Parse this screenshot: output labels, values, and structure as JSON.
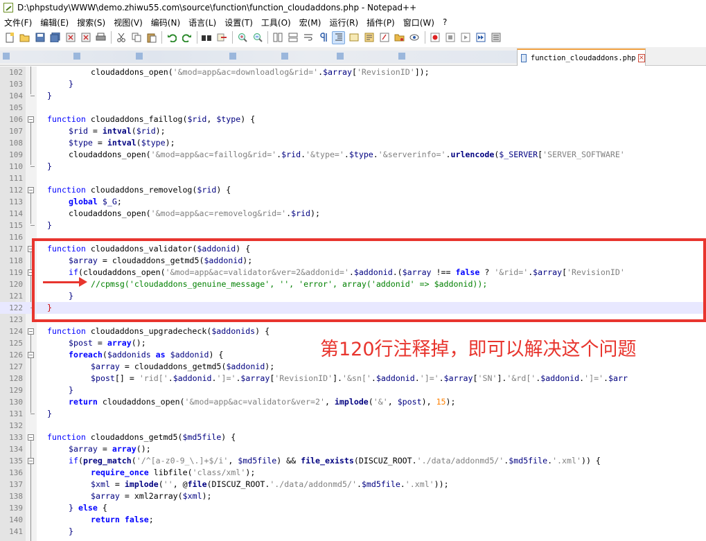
{
  "window": {
    "title": "D:\\phpstudy\\WWW\\demo.zhiwu55.com\\source\\function\\function_cloudaddons.php - Notepad++"
  },
  "menu": [
    "文件(F)",
    "编辑(E)",
    "搜索(S)",
    "视图(V)",
    "编码(N)",
    "语言(L)",
    "设置(T)",
    "工具(O)",
    "宏(M)",
    "运行(R)",
    "插件(P)",
    "窗口(W)",
    "?"
  ],
  "toolbar": {
    "icons": [
      "new-file-icon",
      "open-file-icon",
      "save-icon",
      "save-all-icon",
      "close-icon",
      "close-all-icon",
      "print-icon",
      "cut-icon",
      "copy-icon",
      "paste-icon",
      "undo-icon",
      "redo-icon",
      "find-icon",
      "replace-icon",
      "zoom-in-icon",
      "zoom-out-icon",
      "sync-vertical-icon",
      "sync-horizontal-icon",
      "word-wrap-icon",
      "show-all-chars-icon",
      "indent-guide-icon",
      "user-lang-icon",
      "doc-map-icon",
      "function-list-icon",
      "folder-workspace-icon",
      "monitoring-icon",
      "record-macro-icon",
      "stop-macro-icon",
      "play-macro-icon",
      "run-macro-multiple-icon",
      "save-macro-icon"
    ]
  },
  "tabs": {
    "active": "function_cloudaddons.php"
  },
  "editor": {
    "lines": [
      {
        "n": "102",
        "code": "cloudaddons_open('&mod=app&ac=downloadlog&rid='.$array['RevisionID']);"
      },
      {
        "n": "103",
        "code": "}"
      },
      {
        "n": "104",
        "code": "}"
      },
      {
        "n": "105",
        "code": ""
      },
      {
        "n": "106",
        "code": "function cloudaddons_faillog($rid, $type) {"
      },
      {
        "n": "107",
        "code": "$rid = intval($rid);"
      },
      {
        "n": "108",
        "code": "$type = intval($type);"
      },
      {
        "n": "109",
        "code": "cloudaddons_open('&mod=app&ac=faillog&rid='.$rid.'&type='.$type.'&serverinfo='.urlencode($_SERVER['SERVER_SOFTWARE'"
      },
      {
        "n": "110",
        "code": "}"
      },
      {
        "n": "111",
        "code": ""
      },
      {
        "n": "112",
        "code": "function cloudaddons_removelog($rid) {"
      },
      {
        "n": "113",
        "code": "global $_G;"
      },
      {
        "n": "114",
        "code": "cloudaddons_open('&mod=app&ac=removelog&rid='.$rid);"
      },
      {
        "n": "115",
        "code": "}"
      },
      {
        "n": "116",
        "code": ""
      },
      {
        "n": "117",
        "code": "function cloudaddons_validator($addonid) {"
      },
      {
        "n": "118",
        "code": "$array = cloudaddons_getmd5($addonid);"
      },
      {
        "n": "119",
        "code": "if(cloudaddons_open('&mod=app&ac=validator&ver=2&addonid='.$addonid.($array !== false ? '&rid='.$array['RevisionID'"
      },
      {
        "n": "120",
        "code": "//cpmsg('cloudaddons_genuine_message', '', 'error', array('addonid' => $addonid));"
      },
      {
        "n": "121",
        "code": "}"
      },
      {
        "n": "122",
        "code": "}"
      },
      {
        "n": "123",
        "code": ""
      },
      {
        "n": "124",
        "code": "function cloudaddons_upgradecheck($addonids) {"
      },
      {
        "n": "125",
        "code": "$post = array();"
      },
      {
        "n": "126",
        "code": "foreach($addonids as $addonid) {"
      },
      {
        "n": "127",
        "code": "$array = cloudaddons_getmd5($addonid);"
      },
      {
        "n": "128",
        "code": "$post[] = 'rid['.$addonid.']='.$array['RevisionID'].'&sn['.$addonid.']='.$array['SN'].'&rd['.$addonid.']='.$arr"
      },
      {
        "n": "129",
        "code": "}"
      },
      {
        "n": "130",
        "code": "return cloudaddons_open('&mod=app&ac=validator&ver=2', implode('&', $post), 15);"
      },
      {
        "n": "131",
        "code": "}"
      },
      {
        "n": "132",
        "code": ""
      },
      {
        "n": "133",
        "code": "function cloudaddons_getmd5($md5file) {"
      },
      {
        "n": "134",
        "code": "$array = array();"
      },
      {
        "n": "135",
        "code": "if(preg_match('/^[a-z0-9_\\.]+$/i', $md5file) && file_exists(DISCUZ_ROOT.'./data/addonmd5/'.$md5file.'.xml')) {"
      },
      {
        "n": "136",
        "code": "require_once libfile('class/xml');"
      },
      {
        "n": "137",
        "code": "$xml = implode('', @file(DISCUZ_ROOT.'./data/addonmd5/'.$md5file.'.xml'));"
      },
      {
        "n": "138",
        "code": "$array = xml2array($xml);"
      },
      {
        "n": "139",
        "code": "} else {"
      },
      {
        "n": "140",
        "code": "return false;"
      },
      {
        "n": "141",
        "code": "}"
      }
    ]
  },
  "annotation": {
    "text": "第120行注释掉，即可以解决这个问题",
    "color": "#e8352e"
  },
  "colors": {
    "keyword": "#0000ff",
    "string": "#808080",
    "comment": "#008000",
    "variable": "#000080",
    "number": "#ff8000",
    "current_line": "#e8e8ff"
  }
}
